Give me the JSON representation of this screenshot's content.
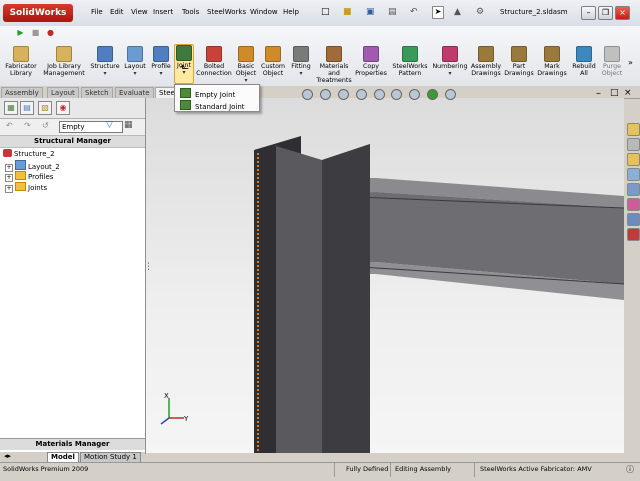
{
  "app": {
    "name": "SolidWorks",
    "title": "Structure_2.sldasm"
  },
  "menu": [
    "File",
    "Edit",
    "View",
    "Insert",
    "Tools",
    "SteelWorks",
    "Window",
    "Help"
  ],
  "ribbon": {
    "buttons": [
      {
        "label": "Fabricator Library",
        "color": "#d8b25a"
      },
      {
        "label": "Job Library Management",
        "color": "#d8b25a"
      },
      {
        "label": "Structure",
        "color": "#4f7fc0"
      },
      {
        "label": "Layout",
        "color": "#6a9bd1"
      },
      {
        "label": "Profile",
        "color": "#4f7fc0"
      },
      {
        "label": "Joint",
        "color": "#3e7a3a"
      },
      {
        "label": "Bolted Connection",
        "color": "#c8423a"
      },
      {
        "label": "Basic Object",
        "color": "#d08a2a"
      },
      {
        "label": "Custom Object",
        "color": "#d08a2a"
      },
      {
        "label": "Fitting",
        "color": "#7a7a7a"
      },
      {
        "label": "Materials and Treatments",
        "color": "#a06a3a"
      },
      {
        "label": "Copy Properties",
        "color": "#a05ab0"
      },
      {
        "label": "SteelWorks Pattern",
        "color": "#3a9a5a"
      },
      {
        "label": "Numbering",
        "color": "#c03a6a"
      },
      {
        "label": "Assembly Drawings",
        "color": "#9a7a3a"
      },
      {
        "label": "Part Drawings",
        "color": "#9a7a3a"
      },
      {
        "label": "Mark Drawings",
        "color": "#9a7a3a"
      },
      {
        "label": "Rebuild All",
        "color": "#3a8ac0"
      },
      {
        "label": "Purge Object",
        "color": "#c0c0c0"
      }
    ]
  },
  "tabs": [
    "Assembly",
    "Layout",
    "Sketch",
    "Evaluate",
    "Stee"
  ],
  "dropdown": {
    "items": [
      "Empty Joint",
      "Standard Joint"
    ]
  },
  "filter": {
    "value": "Empty"
  },
  "panel": {
    "title": "Structural Manager",
    "tree": {
      "root": "Structure_2",
      "children": [
        "Layout_2",
        "Profiles",
        "Joints"
      ]
    },
    "materials_title": "Materials Manager"
  },
  "bottom_tabs": [
    "Model",
    "Motion Study 1"
  ],
  "status": {
    "product": "SolidWorks Premium 2009",
    "state": "Fully Defined",
    "mode": "Editing Assembly",
    "fabricator": "SteelWorks Active Fabricator: AMV"
  },
  "axes": {
    "x": "X",
    "y": "Y"
  },
  "colors": {
    "beam_dark": "#2f2f33",
    "beam_web": "#5a5a5e",
    "beam_flange": "#74747a",
    "weld": "#c8822a"
  }
}
